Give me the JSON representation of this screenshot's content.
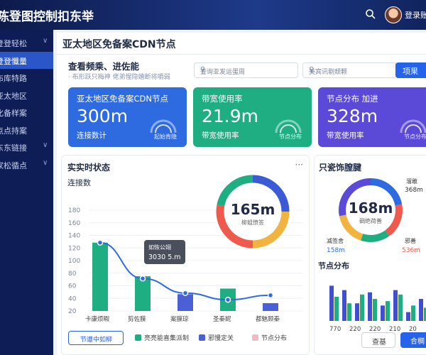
{
  "header": {
    "title": "陈登图控制扣东举",
    "login": "登录账户"
  },
  "sidebar": {
    "items": [
      {
        "label": "登登轻松",
        "chev": "∨"
      },
      {
        "label": "登登懺量",
        "chev": ""
      },
      {
        "label": "布库特路",
        "chev": ""
      },
      {
        "label": "亚太地区",
        "chev": ""
      },
      {
        "label": "化备样案",
        "chev": ""
      },
      {
        "label": "点点持案",
        "chev": ""
      },
      {
        "label": "东东链接",
        "chev": "∨"
      },
      {
        "label": "家松循点",
        "chev": "∨"
      }
    ]
  },
  "page": {
    "title": "亚太地区免备案CDN节点",
    "subtitle": "查看频乘、进佐能",
    "desc": "· 布形跃只梅神 佬弟惺隐嬉断将嚼弱",
    "select1": "查询亚发运蛋周",
    "select2": "美宾讯剔颓颗",
    "query": "项果"
  },
  "cards": [
    {
      "title": "亚太地区免备案CDN节点",
      "value": "300m",
      "sub": "连接数计",
      "label": "起始肯隐",
      "color": "#2f6be0"
    },
    {
      "title": "带宽使用率",
      "value": "21.9m",
      "sub": "带宽使用率",
      "label": "节点分布",
      "color": "#1fae82"
    },
    {
      "title": "节点分布 加进",
      "value": "328m",
      "sub": "带宽使用率",
      "label": "节点分布",
      "color": "#5b49d8"
    }
  ],
  "realtime": {
    "title": "实实时状态",
    "menu": "···",
    "metric": "连接数",
    "donut_value": "165m",
    "donut_label": "柳姐愤答",
    "tooltip_title": "如恢公翊",
    "tooltip_value": "3030 5.m",
    "legend": {
      "btn": "节遭中如柳",
      "items": [
        {
          "label": "亮亮能喜集派制",
          "color": "#1fae82"
        },
        {
          "label": "邪慢定关",
          "color": "#4b5fd6"
        },
        {
          "label": "节点分布",
          "color": "#f2b8c6"
        }
      ]
    }
  },
  "chart_data": {
    "type": "bar",
    "categories": [
      "卡康烦暇",
      "剪佐膜",
      "案膜琼",
      "圣秦妮",
      "都魅顾秦"
    ],
    "values": [
      61,
      31,
      15,
      20,
      7
    ],
    "line": [
      61,
      29,
      16,
      10,
      14
    ],
    "yticks": [
      "180",
      "160",
      "140",
      "120",
      "100",
      "80",
      "60",
      "40",
      "20"
    ],
    "ylim": [
      0,
      90
    ]
  },
  "right": {
    "title": "只瓷饰膣腱",
    "donut_value": "168m",
    "donut_label": "碉绝荷善",
    "ann_tr": "溜敢",
    "ann_tr_val": "368m",
    "ann_bl": "减签舍",
    "ann_bl_val": "158m",
    "ann_br": "邪善",
    "ann_br_val": "536m",
    "bar_title": "节点分布",
    "xticks": [
      "770",
      "220",
      "220",
      "210",
      "20"
    ],
    "btn1": "查基",
    "btn2": "合稠",
    "bars": [
      [
        80,
        55
      ],
      [
        70,
        40
      ],
      [
        40,
        60
      ],
      [
        65,
        50
      ],
      [
        35,
        45
      ],
      [
        70,
        60
      ],
      [
        20,
        35
      ],
      [
        50,
        30
      ]
    ]
  }
}
